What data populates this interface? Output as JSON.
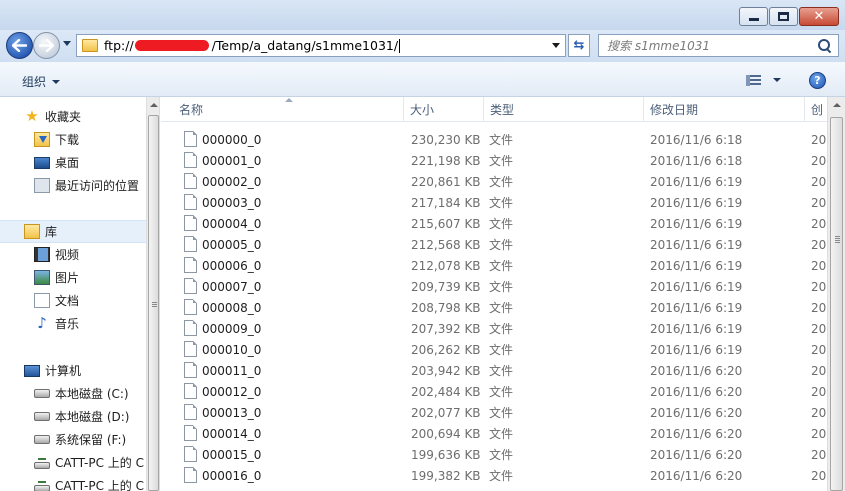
{
  "address": {
    "prefix": "ftp://",
    "suffix": "/Temp/a_datang/s1mme1031/"
  },
  "search": {
    "placeholder": "搜索 s1mme1031"
  },
  "toolbar": {
    "organize_label": "组织"
  },
  "sidebar": {
    "favorites": {
      "label": "收藏夹",
      "items": [
        "下载",
        "桌面",
        "最近访问的位置"
      ]
    },
    "libraries": {
      "label": "库",
      "items": [
        "视频",
        "图片",
        "文档",
        "音乐"
      ]
    },
    "computer": {
      "label": "计算机",
      "items": [
        "本地磁盘 (C:)",
        "本地磁盘 (D:)",
        "系统保留 (F:)",
        "CATT-PC 上的 C",
        "CATT-PC 上的 C"
      ]
    }
  },
  "columns": {
    "name": "名称",
    "size": "大小",
    "type": "类型",
    "date": "修改日期",
    "created": "创"
  },
  "files": [
    {
      "name": "000000_0",
      "size": "230,230 KB",
      "type": "文件",
      "date": "2016/11/6 6:18",
      "cut": "20"
    },
    {
      "name": "000001_0",
      "size": "221,198 KB",
      "type": "文件",
      "date": "2016/11/6 6:18",
      "cut": "20"
    },
    {
      "name": "000002_0",
      "size": "220,861 KB",
      "type": "文件",
      "date": "2016/11/6 6:19",
      "cut": "20"
    },
    {
      "name": "000003_0",
      "size": "217,184 KB",
      "type": "文件",
      "date": "2016/11/6 6:19",
      "cut": "20"
    },
    {
      "name": "000004_0",
      "size": "215,607 KB",
      "type": "文件",
      "date": "2016/11/6 6:19",
      "cut": "20"
    },
    {
      "name": "000005_0",
      "size": "212,568 KB",
      "type": "文件",
      "date": "2016/11/6 6:19",
      "cut": "20"
    },
    {
      "name": "000006_0",
      "size": "212,078 KB",
      "type": "文件",
      "date": "2016/11/6 6:19",
      "cut": "20"
    },
    {
      "name": "000007_0",
      "size": "209,739 KB",
      "type": "文件",
      "date": "2016/11/6 6:19",
      "cut": "20"
    },
    {
      "name": "000008_0",
      "size": "208,798 KB",
      "type": "文件",
      "date": "2016/11/6 6:19",
      "cut": "20"
    },
    {
      "name": "000009_0",
      "size": "207,392 KB",
      "type": "文件",
      "date": "2016/11/6 6:19",
      "cut": "20"
    },
    {
      "name": "000010_0",
      "size": "206,262 KB",
      "type": "文件",
      "date": "2016/11/6 6:19",
      "cut": "20"
    },
    {
      "name": "000011_0",
      "size": "203,942 KB",
      "type": "文件",
      "date": "2016/11/6 6:20",
      "cut": "20"
    },
    {
      "name": "000012_0",
      "size": "202,484 KB",
      "type": "文件",
      "date": "2016/11/6 6:20",
      "cut": "20"
    },
    {
      "name": "000013_0",
      "size": "202,077 KB",
      "type": "文件",
      "date": "2016/11/6 6:20",
      "cut": "20"
    },
    {
      "name": "000014_0",
      "size": "200,694 KB",
      "type": "文件",
      "date": "2016/11/6 6:20",
      "cut": "20"
    },
    {
      "name": "000015_0",
      "size": "199,636 KB",
      "type": "文件",
      "date": "2016/11/6 6:20",
      "cut": "20"
    },
    {
      "name": "000016_0",
      "size": "199,382 KB",
      "type": "文件",
      "date": "2016/11/6 6:20",
      "cut": "20"
    }
  ],
  "icons": {
    "window_minimize": "minimize-icon",
    "window_maximize": "maximize-icon",
    "window_close": "close-icon",
    "back": "back-arrow-icon",
    "forward": "forward-arrow-icon",
    "search": "search-icon",
    "help": "help-icon",
    "file": "file-icon",
    "folder": "folder-icon"
  },
  "colors": {
    "accent": "#2a5cb5",
    "selected_row": "#e5f0fb",
    "redaction": "#ef1b22"
  }
}
